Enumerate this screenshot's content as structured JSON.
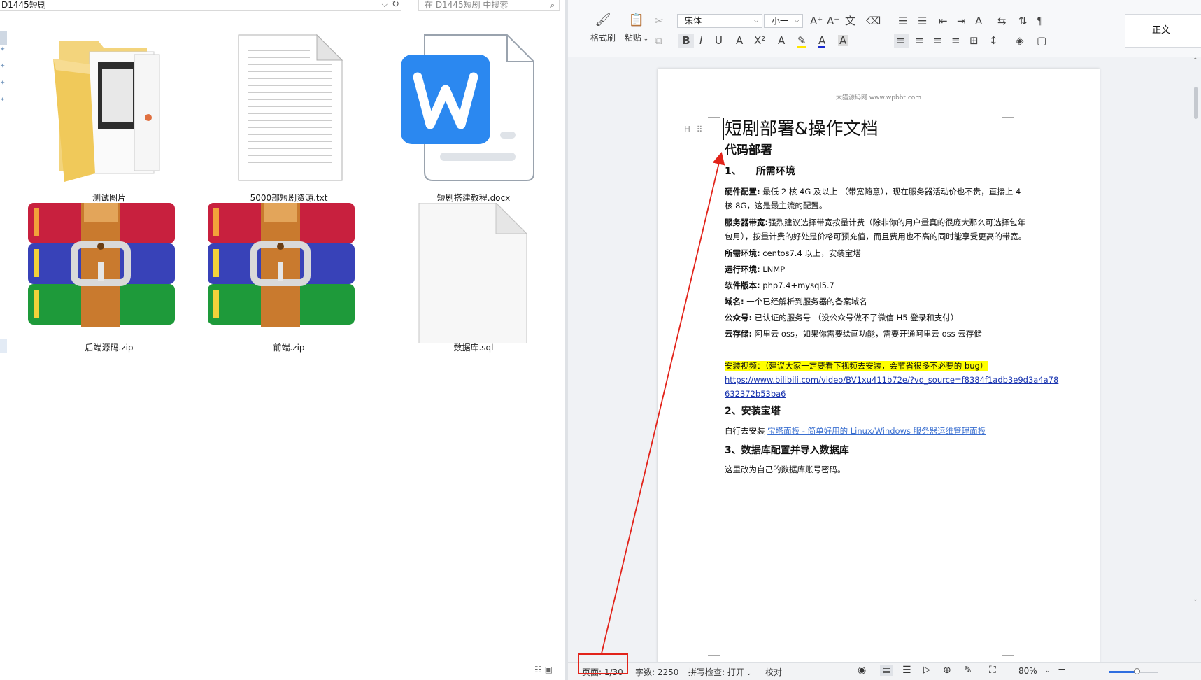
{
  "explorer": {
    "address": "D1445短剧",
    "search_placeholder": "在 D1445短剧 中搜索",
    "files": [
      {
        "name": "测试图片",
        "type": "folder"
      },
      {
        "name": "5000部短剧资源.txt",
        "type": "text"
      },
      {
        "name": "短剧搭建教程.docx",
        "type": "wps-doc"
      },
      {
        "name": "后端源码.zip",
        "type": "winrar"
      },
      {
        "name": "前端.zip",
        "type": "winrar"
      },
      {
        "name": "数据库.sql",
        "type": "blank"
      }
    ]
  },
  "wps": {
    "ribbon": {
      "format_painter": "格式刷",
      "paste": "粘贴",
      "font_name": "宋体",
      "font_size": "小一",
      "style_label": "正文"
    },
    "doc": {
      "header": "大猫源码网 www.wpbbt.com",
      "title": "短剧部署&操作文档",
      "h1": "代码部署",
      "sec1": "1、　　所需环境",
      "hw_label": "硬件配置:",
      "hw_text1": " 最低 2 核 4G 及以上 （带宽随意），现在服务器活动价也不贵，直接上 4",
      "hw_text2": "核 8G，这是最主流的配置。",
      "bw_label": "服务器带宽:",
      "bw_text1": "强烈建议选择带宽按量计费（除非你的用户量真的很庞大那么可选择包年",
      "bw_text2": "包月），按量计费的好处是价格可预充值，而且费用也不高的同时能享受更高的带宽。",
      "env_label": "所需环境:",
      "env_text": " centos7.4 以上，安装宝塔",
      "run_label": "运行环境:",
      "run_text": " LNMP",
      "sw_label": "软件版本:",
      "sw_text": " php7.4+mysql5.7",
      "domain_label": "域名:",
      "domain_text": " 一个已经解析到服务器的备案域名",
      "mp_label": "公众号:",
      "mp_text": " 已认证的服务号 （没公众号做不了微信 H5 登录和支付）",
      "oss_label": "云存储:",
      "oss_text": " 阿里云 oss，如果你需要绘画功能，需要开通阿里云 oss 云存储",
      "video_note": "安装视频：（建议大家一定要看下视频去安装，会节省很多不必要的 bug）",
      "video_url1": "https://www.bilibili.com/video/BV1xu411b72e/?vd_source=f8384f1adb3e9d3a4a78",
      "video_url2": "632372b53ba6",
      "sec2": "2、安装宝塔",
      "bt_text": "自行去安装 ",
      "bt_link": "宝塔面板 - 简单好用的 Linux/Windows 服务器运维管理面板",
      "sec3": "3、数据库配置并导入数据库",
      "db_text": "这里改为自己的数据库账号密码。"
    },
    "status": {
      "page": "页面: 1/30",
      "words": "字数: 2250",
      "spell": "拼写检查: 打开",
      "proof": "校对",
      "zoom": "80%",
      "zoom_level": 0.55
    }
  },
  "colors": {
    "annotation": "#e2231a",
    "highlight": "#ffff00",
    "wps_blue": "#2b88f0"
  }
}
